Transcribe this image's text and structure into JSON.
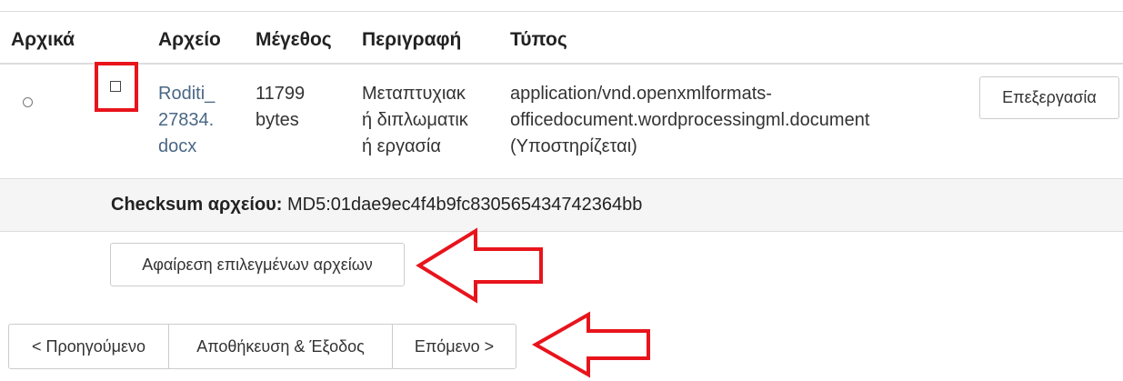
{
  "table": {
    "headers": {
      "original": "Αρχικά",
      "file": "Αρχείο",
      "size": "Μέγεθος",
      "description": "Περιγραφή",
      "type": "Τύπος"
    },
    "row": {
      "file_line1": "Roditi_",
      "file_line2": "27834.",
      "file_line3": "docx",
      "size_line1": "11799",
      "size_line2": "bytes",
      "desc_line1": "Μεταπτυχιακ",
      "desc_line2": "ή διπλωματικ",
      "desc_line3": "ή εργασία",
      "type_line1": "application/vnd.openxmlformats-",
      "type_line2": "officedocument.wordprocessingml.document",
      "type_line3": "(Υποστηρίζεται)",
      "edit_label": "Επεξεργασία"
    },
    "checksum_label": "Checksum αρχείου:",
    "checksum_value": " MD5:01dae9ec4f4b9fc830565434742364bb"
  },
  "actions": {
    "remove_label": "Αφαίρεση επιλεγμένων αρχείων"
  },
  "nav": {
    "prev_label": "< Προηγούμενο",
    "save_exit_label": "Αποθήκευση & Έξοδος",
    "next_label": "Επόμενο >"
  },
  "colors": {
    "link": "#4a6785",
    "highlight": "#e8141c",
    "border": "#cccccc"
  }
}
